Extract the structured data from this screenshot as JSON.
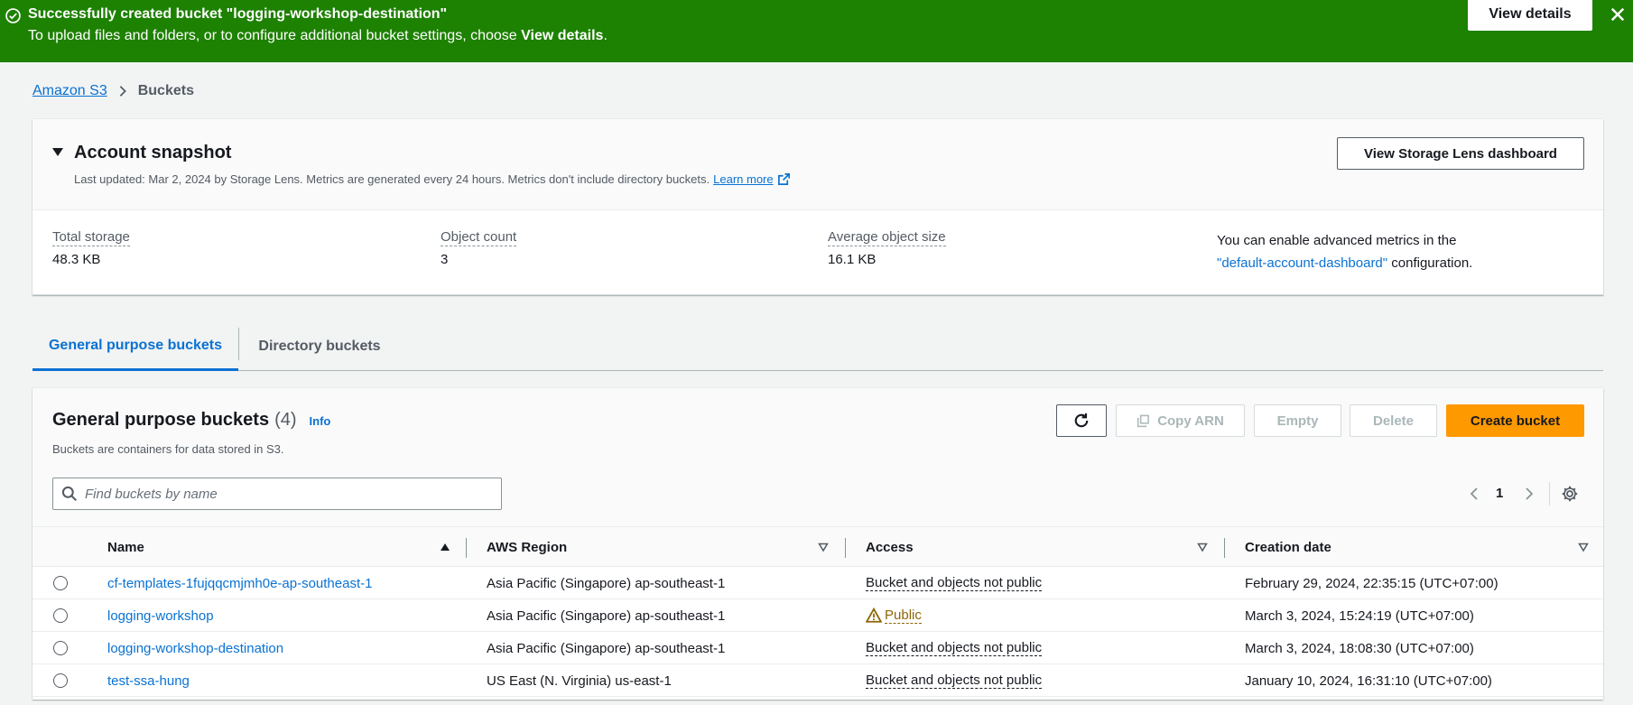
{
  "flash": {
    "title": "Successfully created bucket \"logging-workshop-destination\"",
    "desc_prefix": "To upload files and folders, or to configure additional bucket settings, choose ",
    "desc_bold": "View details",
    "desc_suffix": ".",
    "view_button": "View details",
    "color": "#1d8102"
  },
  "breadcrumb": {
    "root": "Amazon S3",
    "current": "Buckets"
  },
  "snapshot": {
    "title": "Account snapshot",
    "subtitle": "Last updated: Mar 2, 2024 by Storage Lens. Metrics are generated every 24 hours. Metrics don't include directory buckets.",
    "learn_more": "Learn more",
    "lens_button": "View Storage Lens dashboard",
    "metrics": [
      {
        "label": "Total storage",
        "value": "48.3 KB"
      },
      {
        "label": "Object count",
        "value": "3"
      },
      {
        "label": "Average object size",
        "value": "16.1 KB"
      }
    ],
    "advanced_text": "You can enable advanced metrics in the",
    "advanced_link": "\"default-account-dashboard\"",
    "advanced_suffix": " configuration."
  },
  "tabs": [
    {
      "label": "General purpose buckets",
      "active": true
    },
    {
      "label": "Directory buckets",
      "active": false
    }
  ],
  "panel": {
    "title": "General purpose buckets",
    "count": "(4)",
    "info": "Info",
    "description": "Buckets are containers for data stored in S3.",
    "buttons": {
      "copy_arn": "Copy ARN",
      "empty": "Empty",
      "delete": "Delete",
      "create": "Create bucket"
    },
    "search_placeholder": "Find buckets by name",
    "page": "1",
    "accent": "#ff9900"
  },
  "table": {
    "columns": [
      "Name",
      "AWS Region",
      "Access",
      "Creation date"
    ],
    "rows": [
      {
        "name": "cf-templates-1fujqqcmjmh0e-ap-southeast-1",
        "region": "Asia Pacific (Singapore) ap-southeast-1",
        "access": "Bucket and objects not public",
        "public": false,
        "created": "February 29, 2024, 22:35:15 (UTC+07:00)"
      },
      {
        "name": "logging-workshop",
        "region": "Asia Pacific (Singapore) ap-southeast-1",
        "access": "Public",
        "public": true,
        "created": "March 3, 2024, 15:24:19 (UTC+07:00)"
      },
      {
        "name": "logging-workshop-destination",
        "region": "Asia Pacific (Singapore) ap-southeast-1",
        "access": "Bucket and objects not public",
        "public": false,
        "created": "March 3, 2024, 18:08:30 (UTC+07:00)"
      },
      {
        "name": "test-ssa-hung",
        "region": "US East (N. Virginia) us-east-1",
        "access": "Bucket and objects not public",
        "public": false,
        "created": "January 10, 2024, 16:31:10 (UTC+07:00)"
      }
    ]
  }
}
